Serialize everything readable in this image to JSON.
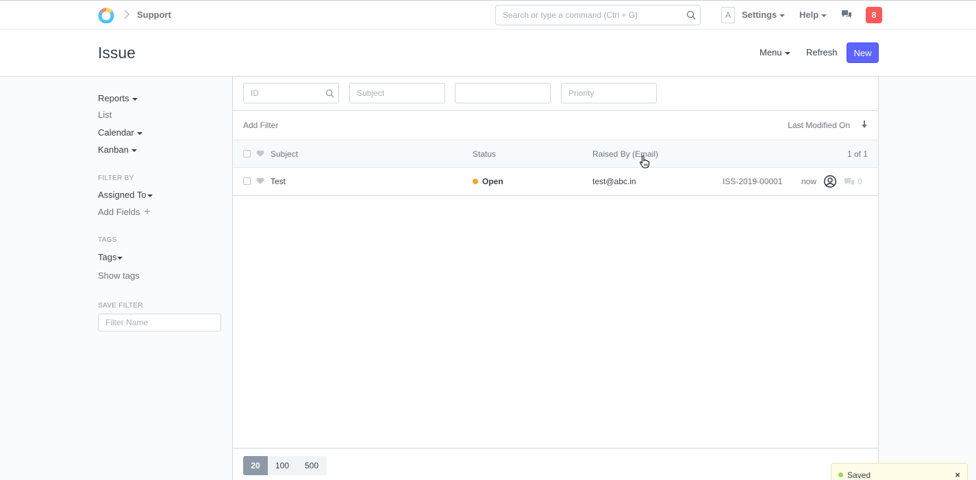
{
  "navbar": {
    "breadcrumb": "Support",
    "search_placeholder": "Search or type a command (Ctrl + G)",
    "avatar_letter": "A",
    "settings_label": "Settings",
    "help_label": "Help",
    "notification_count": "8"
  },
  "page": {
    "title": "Issue",
    "menu_label": "Menu",
    "refresh_label": "Refresh",
    "new_label": "New"
  },
  "sidebar": {
    "reports": "Reports",
    "list": "List",
    "calendar": "Calendar",
    "kanban": "Kanban",
    "filter_by_heading": "FILTER BY",
    "assigned_to": "Assigned To",
    "add_fields": "Add Fields",
    "tags_heading": "TAGS",
    "tags": "Tags",
    "show_tags": "Show tags",
    "save_filter_heading": "SAVE FILTER",
    "filter_name_placeholder": "Filter Name"
  },
  "filters": {
    "id_placeholder": "ID",
    "subject_placeholder": "Subject",
    "blank_placeholder": "",
    "priority_placeholder": "Priority",
    "add_filter": "Add Filter",
    "sort_label": "Last Modified On"
  },
  "list": {
    "headers": {
      "subject": "Subject",
      "status": "Status",
      "raised_by": "Raised By (Email)",
      "count": "1 of 1"
    },
    "rows": [
      {
        "subject": "Test",
        "status": "Open",
        "status_color": "#f8a12d",
        "raised_by": "test@abc.in",
        "name": "ISS-2019-00001",
        "modified": "now",
        "comments": "0"
      }
    ]
  },
  "paging": {
    "sizes": [
      "20",
      "100",
      "500"
    ],
    "active": "20"
  },
  "toast": {
    "text": "Saved"
  },
  "colors": {
    "primary": "#5e64ff",
    "badge": "#ff5858",
    "open_status": "#f8a12d"
  }
}
